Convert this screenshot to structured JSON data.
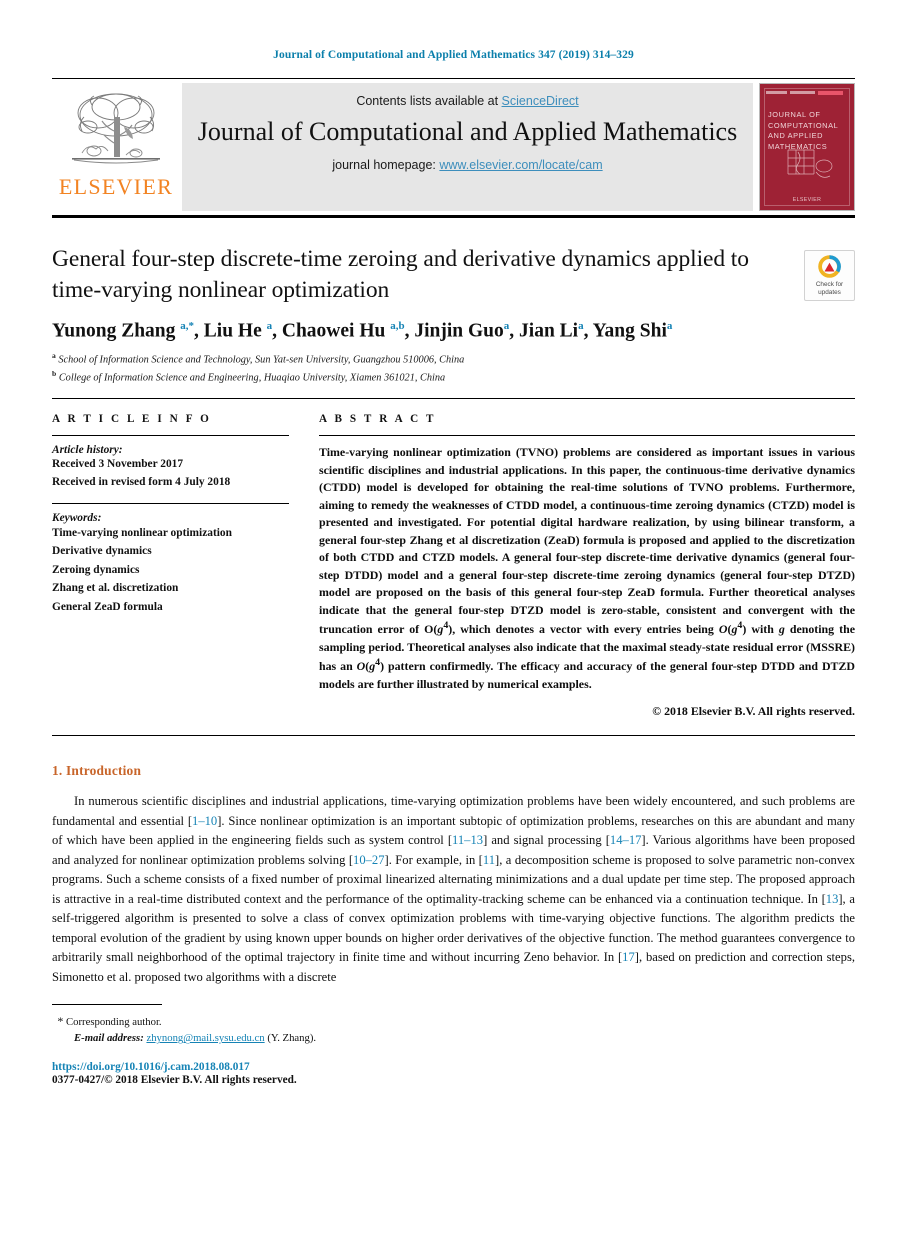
{
  "running_head": "Journal of Computational and Applied Mathematics 347 (2019) 314–329",
  "masthead": {
    "contents_prefix": "Contents lists available at ",
    "sciencedirect": "ScienceDirect",
    "journal_title": "Journal of Computational and Applied Mathematics",
    "homepage_prefix": "journal homepage: ",
    "homepage_url": "www.elsevier.com/locate/cam",
    "publisher": "ELSEVIER",
    "cover_title": "JOURNAL OF COMPUTATIONAL AND APPLIED MATHEMATICS",
    "cover_footer": "ELSEVIER"
  },
  "article": {
    "title": "General four-step discrete-time zeroing and derivative dynamics applied to time-varying nonlinear optimization",
    "crossmark_line1": "Check for",
    "crossmark_line2": "updates",
    "authors_html": "Yunong Zhang <sup>a,*</sup>, Liu He <sup>a</sup>, Chaowei Hu <sup>a,b</sup>, Jinjin Guo<sup>a</sup>, Jian Li<sup>a</sup>, Yang Shi<sup>a</sup>",
    "affiliations": [
      {
        "mark": "a",
        "text": "School of Information Science and Technology, Sun Yat-sen University, Guangzhou 510006, China"
      },
      {
        "mark": "b",
        "text": "College of Information Science and Engineering, Huaqiao University, Xiamen 361021, China"
      }
    ]
  },
  "article_info": {
    "heading": "A R T I C L E   I N F O",
    "history_label": "Article history:",
    "history": [
      "Received 3 November 2017",
      "Received in revised form 4 July 2018"
    ],
    "keywords_label": "Keywords:",
    "keywords": [
      "Time-varying nonlinear optimization",
      "Derivative dynamics",
      "Zeroing dynamics",
      "Zhang et al. discretization",
      "General ZeaD formula"
    ]
  },
  "abstract": {
    "heading": "A B S T R A C T",
    "text_html": "Time-varying nonlinear optimization (TVNO) problems are considered as important issues in various scientific disciplines and industrial applications. In this paper, the continuous-time derivative dynamics (CTDD) model is developed for obtaining the real-time solutions of TVNO problems. Furthermore, aiming to remedy the weaknesses of CTDD model, a continuous-time zeroing dynamics (CTZD) model is presented and investigated. For potential digital hardware realization, by using bilinear transform, a general four-step Zhang et al discretization (ZeaD) formula is proposed and applied to the discretization of both CTDD and CTZD models. A general four-step discrete-time derivative dynamics (general four-step DTDD) model and a general four-step discrete-time zeroing dynamics (general four-step DTZD) model are proposed on the basis of this general four-step ZeaD formula. Further theoretical analyses indicate that the general four-step DTZD model is zero-stable, consistent and convergent with the truncation error of O(<em>g</em><sup>4</sup>), which denotes a vector with every entries being <em>O</em>(<em>g</em><sup>4</sup>) with <em>g</em> denoting the sampling period. Theoretical analyses also indicate that the maximal steady-state residual error (MSSRE) has an <em>O</em>(<em>g</em><sup>4</sup>) pattern confirmedly. The efficacy and accuracy of the general four-step DTDD and DTZD models are further illustrated by numerical examples.",
    "copyright": "© 2018 Elsevier B.V. All rights reserved."
  },
  "introduction": {
    "number": "1.",
    "heading": "Introduction",
    "paragraph_html": "In numerous scientific disciplines and industrial applications, time-varying optimization problems have been widely encountered, and such problems are fundamental and essential [<span class=\"cite\">1–10</span>]. Since nonlinear optimization is an important subtopic of optimization problems, researches on this are abundant and many of which have been applied in the engineering fields such as system control [<span class=\"cite\">11–13</span>] and signal processing [<span class=\"cite\">14–17</span>]. Various algorithms have been proposed and analyzed for nonlinear optimization problems solving [<span class=\"cite\">10–27</span>]. For example, in [<span class=\"cite\">11</span>], a decomposition scheme is proposed to solve parametric non-convex programs. Such a scheme consists of a fixed number of proximal linearized alternating minimizations and a dual update per time step. The proposed approach is attractive in a real-time distributed context and the performance of the optimality-tracking scheme can be enhanced via a continuation technique. In [<span class=\"cite\">13</span>], a self-triggered algorithm is presented to solve a class of convex optimization problems with time-varying objective functions. The algorithm predicts the temporal evolution of the gradient by using known upper bounds on higher order derivatives of the objective function. The method guarantees convergence to arbitrarily small neighborhood of the optimal trajectory in finite time and without incurring Zeno behavior. In [<span class=\"cite\">17</span>], based on prediction and correction steps, Simonetto et al. proposed two algorithms with a discrete"
  },
  "footnotes": {
    "corresponding_marker": "*",
    "corresponding_text": "Corresponding author.",
    "email_label": "E-mail address:",
    "email": "zhynong@mail.sysu.edu.cn",
    "email_suffix": "(Y. Zhang).",
    "doi": "https://doi.org/10.1016/j.cam.2018.08.017",
    "issn_line": "0377-0427/© 2018 Elsevier B.V. All rights reserved."
  },
  "colors": {
    "link_blue": "#1583b5",
    "sciencedirect_blue": "#3d8ebc",
    "elsevier_orange": "#f28322",
    "cover_red": "#9e2235",
    "section_head": "#c8652a"
  }
}
